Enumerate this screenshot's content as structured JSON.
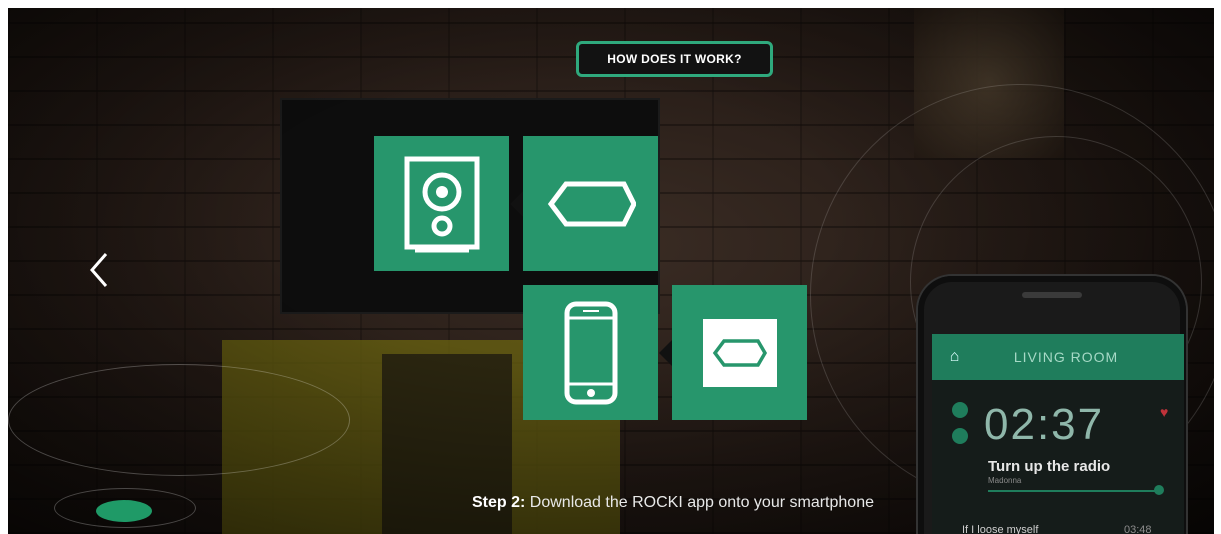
{
  "header": {
    "badge_label": "HOW DOES IT WORK?"
  },
  "tiles": [
    {
      "name": "speaker",
      "icon": "speaker-icon"
    },
    {
      "name": "rocki-device",
      "icon": "hexagon-icon"
    },
    {
      "name": "smartphone",
      "icon": "smartphone-icon"
    },
    {
      "name": "rocki-device-small",
      "icon": "hexagon-icon"
    }
  ],
  "nav": {
    "prev_icon": "chevron-left-icon"
  },
  "phone_app": {
    "room": "LIVING ROOM",
    "time": "02:37",
    "song": "Turn up the radio",
    "artist": "Madonna",
    "next_song": "If I loose myself",
    "next_time": "03:48"
  },
  "caption": {
    "step": "Step 2:",
    "text": "Download the ROCKI app onto your smartphone"
  },
  "colors": {
    "accent": "#27966c",
    "badge_border": "#2fa97d"
  }
}
